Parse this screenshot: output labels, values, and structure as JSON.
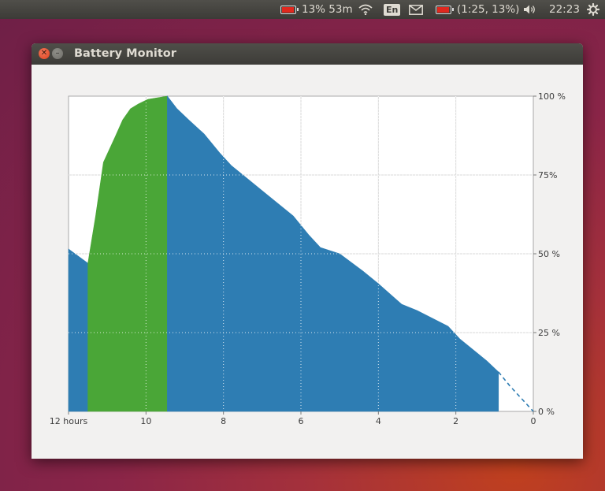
{
  "panel": {
    "battery_status": "13% 53m",
    "keyboard_layout": "En",
    "battery_detail": "(1:25, 13%)",
    "clock": "22:23",
    "battery_level_percent": 13,
    "icons": [
      "battery-icon",
      "wifi-icon",
      "keyboard-layout-icon",
      "mail-icon",
      "battery-icon",
      "volume-icon",
      "power-icon"
    ]
  },
  "window": {
    "title": "Battery Monitor"
  },
  "colors": {
    "discharge": "#2e7db3",
    "charge": "#4aa637",
    "critical": "#e0281e"
  },
  "chart_data": {
    "type": "area",
    "x_unit": "hours ago",
    "xlim": [
      12,
      0
    ],
    "ylim": [
      0,
      100
    ],
    "x_ticks": [
      "12 hours",
      "10",
      "8",
      "6",
      "4",
      "2",
      "0"
    ],
    "y_ticks": [
      "100 %",
      "75%",
      "50 %",
      "25 %",
      "0 %"
    ],
    "grid": true,
    "legend": "none",
    "series": [
      {
        "state": "discharging",
        "points": [
          [
            12,
            51.5
          ],
          [
            11.5,
            47
          ]
        ]
      },
      {
        "state": "charging",
        "points": [
          [
            11.5,
            47
          ],
          [
            11.3,
            62
          ],
          [
            11.1,
            79
          ],
          [
            10.8,
            87
          ],
          [
            10.6,
            92.5
          ],
          [
            10.4,
            96
          ],
          [
            10.2,
            97.5
          ],
          [
            9.95,
            99
          ],
          [
            9.45,
            100
          ]
        ]
      },
      {
        "state": "discharging",
        "points": [
          [
            9.45,
            100
          ],
          [
            9.2,
            96
          ],
          [
            8.9,
            92.5
          ],
          [
            8.5,
            88
          ],
          [
            8.1,
            82
          ],
          [
            7.8,
            78
          ],
          [
            7.4,
            74
          ],
          [
            7.0,
            70
          ],
          [
            6.6,
            66
          ],
          [
            6.2,
            62
          ],
          [
            5.8,
            56
          ],
          [
            5.5,
            52
          ],
          [
            5.0,
            50
          ],
          [
            4.4,
            44.5
          ],
          [
            4.0,
            40.5
          ],
          [
            3.4,
            34
          ],
          [
            3.0,
            32
          ],
          [
            2.6,
            29.5
          ],
          [
            2.2,
            27
          ],
          [
            1.9,
            23
          ],
          [
            1.5,
            19
          ],
          [
            1.2,
            16
          ],
          [
            0.9,
            12.5
          ]
        ]
      },
      {
        "state": "estimated",
        "points": [
          [
            0.9,
            12.5
          ],
          [
            0.6,
            8
          ],
          [
            0.3,
            4
          ],
          [
            0,
            0
          ]
        ]
      }
    ]
  }
}
